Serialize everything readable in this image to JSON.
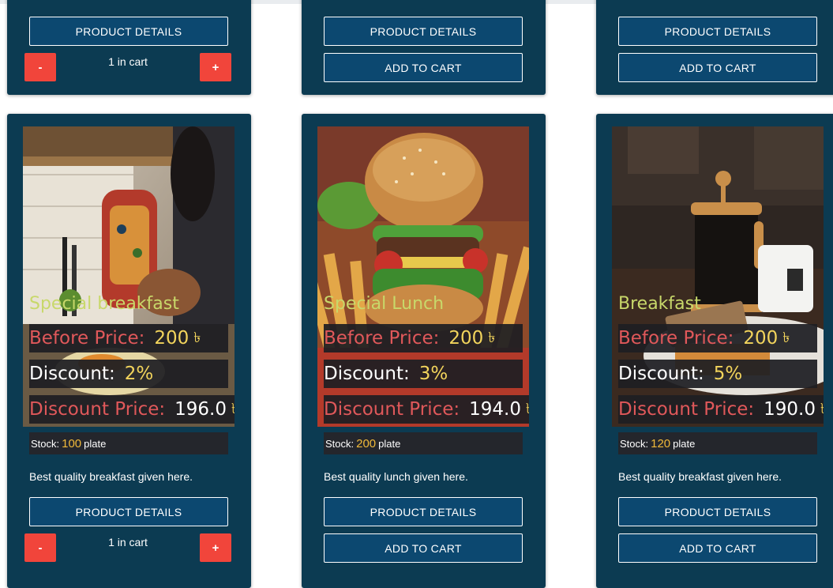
{
  "top_cards": [
    {
      "details_label": "PRODUCT DETAILS",
      "in_cart": true,
      "minus": "-",
      "plus": "+",
      "cart_text": "1 in cart"
    },
    {
      "details_label": "PRODUCT DETAILS",
      "in_cart": false,
      "add_label": "ADD TO CART"
    },
    {
      "details_label": "PRODUCT DETAILS",
      "in_cart": false,
      "add_label": "ADD TO CART"
    }
  ],
  "products": [
    {
      "title": "Special breakfast",
      "before_label": "Before Price:",
      "before_value": "200",
      "currency": "৳",
      "discount_label": "Discount:",
      "discount_value": "2%",
      "after_label": "Discount Price:",
      "after_value": "196.0",
      "stock_label": "Stock:",
      "stock_value": "100",
      "stock_unit": "plate",
      "description": "Best quality breakfast given here.",
      "details_label": "PRODUCT DETAILS",
      "minus": "-",
      "plus": "+",
      "cart_text": "1 in cart"
    },
    {
      "title": "Special Lunch",
      "before_label": "Before Price:",
      "before_value": "200",
      "currency": "৳",
      "discount_label": "Discount:",
      "discount_value": "3%",
      "after_label": "Discount Price:",
      "after_value": "194.0",
      "stock_label": "Stock:",
      "stock_value": "200",
      "stock_unit": "plate",
      "description": "Best quality lunch given here.",
      "details_label": "PRODUCT DETAILS",
      "add_label": "ADD TO CART"
    },
    {
      "title": "Breakfast",
      "before_label": "Before Price:",
      "before_value": "200",
      "currency": "৳",
      "discount_label": "Discount:",
      "discount_value": "5%",
      "after_label": "Discount Price:",
      "after_value": "190.0",
      "stock_label": "Stock:",
      "stock_value": "120",
      "stock_unit": "plate",
      "description": "Best quality breakfast given here.",
      "details_label": "PRODUCT DETAILS",
      "add_label": "ADD TO CART"
    }
  ],
  "colors": {
    "card_bg": "#0c3b52",
    "button_bg": "#0c4870",
    "qty_button": "#f1453b",
    "title_text": "#c8d86a",
    "price_label": "#e0585a",
    "price_value": "#f2d45c",
    "stock_value": "#f0b93a"
  }
}
